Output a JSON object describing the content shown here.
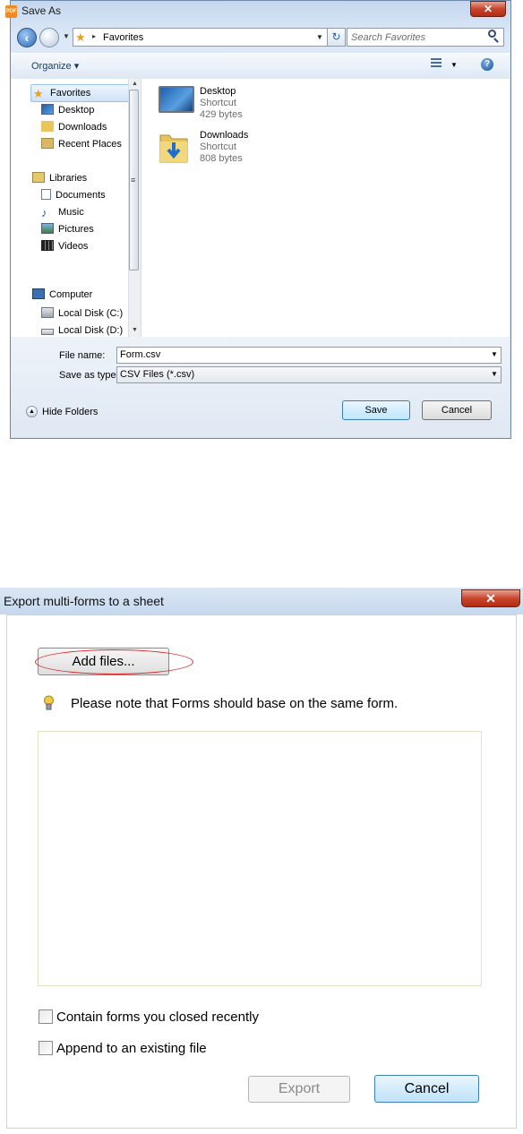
{
  "save_as": {
    "title": "Save As",
    "close_glyph": "✕",
    "address": {
      "location": "Favorites"
    },
    "search": {
      "placeholder": "Search Favorites"
    },
    "toolbar": {
      "organize_label": "Organize ▾"
    },
    "nav": {
      "favorites": "Favorites",
      "desktop": "Desktop",
      "downloads": "Downloads",
      "recent_places": "Recent Places",
      "libraries": "Libraries",
      "documents": "Documents",
      "music": "Music",
      "pictures": "Pictures",
      "videos": "Videos",
      "computer": "Computer",
      "local_disk_c": "Local Disk (C:)",
      "local_disk_d": "Local Disk (D:)"
    },
    "files": [
      {
        "name": "Desktop",
        "type": "Shortcut",
        "size": "429 bytes",
        "icon": "desktop-icon"
      },
      {
        "name": "Downloads",
        "type": "Shortcut",
        "size": "808 bytes",
        "icon": "downloads-folder-icon"
      }
    ],
    "file_name_label": "File name:",
    "file_name_value": "Form.csv",
    "save_type_label": "Save as type:",
    "save_type_value": "CSV Files (*.csv)",
    "hide_folders_label": "Hide Folders",
    "save_button": "Save",
    "cancel_button": "Cancel"
  },
  "export_dialog": {
    "title": "Export multi-forms to a sheet",
    "close_glyph": "✕",
    "add_files_button": "Add files...",
    "note": "Please note that Forms should base on the same form.",
    "checkbox_closed_label": "Contain forms you closed recently",
    "checkbox_closed_checked": false,
    "checkbox_append_label": "Append to an existing file",
    "checkbox_append_checked": false,
    "export_button": "Export",
    "export_enabled": false,
    "cancel_button": "Cancel",
    "highlight_color": "#d9242a"
  }
}
